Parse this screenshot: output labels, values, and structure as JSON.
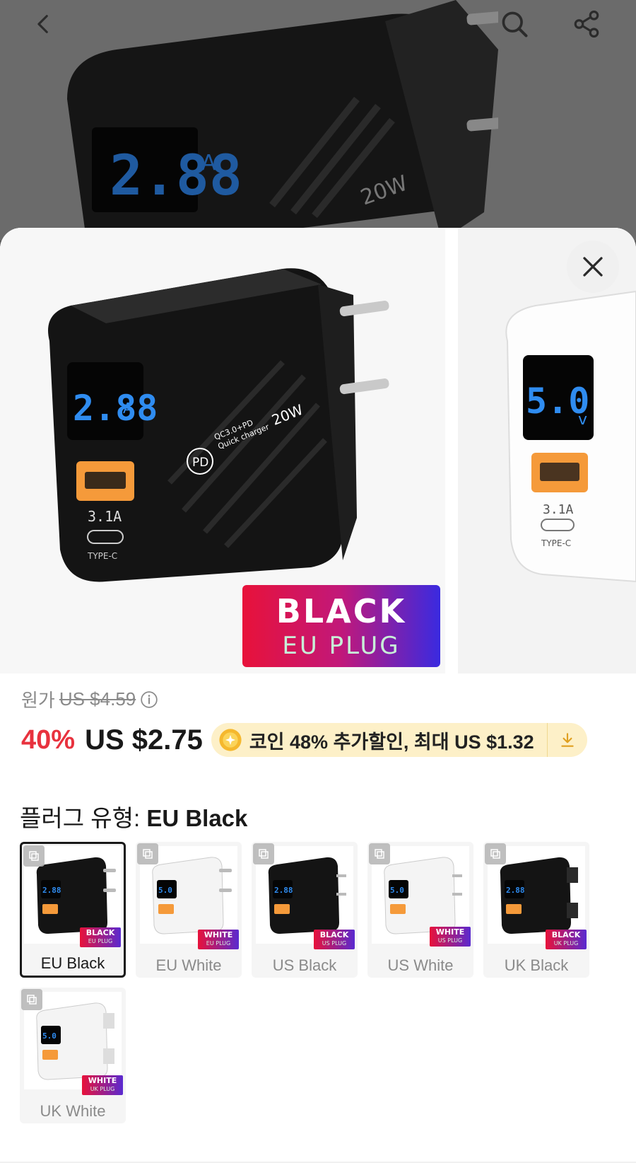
{
  "header": {
    "back_icon": "chevron-left-icon",
    "search_icon": "search-icon",
    "share_icon": "share-icon"
  },
  "gallery": {
    "main_display": "2.88",
    "main_display_unit": "A",
    "brand_text": "PD",
    "charger_spec_line1": "QC3.0+PD",
    "charger_spec_line2": "Quick charger",
    "charger_watt": "20W",
    "port_rating": "3.1A",
    "port_type": "TYPE-C",
    "label_color": "BLACK",
    "label_plug": "EU PLUG",
    "second_display": "5.0",
    "second_display_unit": "v",
    "second_port_rating": "3.1A",
    "second_port_type": "TYPE-C",
    "close_icon": "close-icon"
  },
  "pricing": {
    "original_label": "원가",
    "original_price": "US $4.59",
    "discount": "40%",
    "price": "US $2.75",
    "coin_text": "코인 48% 추가할인, 최대 US $1.32"
  },
  "variant": {
    "title_label": "플러그 유형:",
    "selected_value": "EU Black",
    "options": [
      {
        "name": "EU Black",
        "tag_color": "BLACK",
        "tag_plug": "EU PLUG",
        "color": "black",
        "display": "2.88"
      },
      {
        "name": "EU White",
        "tag_color": "WHITE",
        "tag_plug": "EU PLUG",
        "color": "white",
        "display": "5.0"
      },
      {
        "name": "US Black",
        "tag_color": "BLACK",
        "tag_plug": "US PLUG",
        "color": "black",
        "display": "2.88"
      },
      {
        "name": "US White",
        "tag_color": "WHITE",
        "tag_plug": "US PLUG",
        "color": "white",
        "display": "5.0"
      },
      {
        "name": "UK Black",
        "tag_color": "BLACK",
        "tag_plug": "UK PLUG",
        "color": "black",
        "display": "2.88"
      },
      {
        "name": "UK White",
        "tag_color": "WHITE",
        "tag_plug": "UK PLUG",
        "color": "white",
        "display": "5.0"
      }
    ]
  },
  "colors": {
    "discount_red": "#e8323e",
    "coin_pill_bg": "#fdf0c8",
    "coin_gold": "#f5b82e",
    "display_blue": "#2f8cf0",
    "usb_orange": "#f59a3a"
  }
}
